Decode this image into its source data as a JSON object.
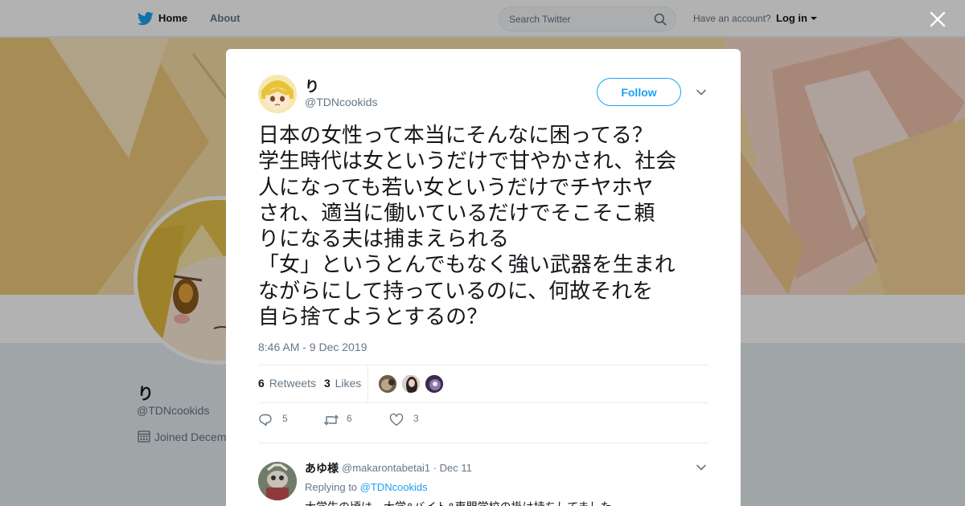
{
  "nav": {
    "home_label": "Home",
    "about_label": "About",
    "search_placeholder": "Search Twitter",
    "have_account": "Have an account?",
    "login_label": "Log in"
  },
  "profile_bg": {
    "name": "り",
    "handle": "@TDNcookids",
    "joined": "Joined Decem"
  },
  "tweet": {
    "author_name": "り",
    "author_handle": "@TDNcookids",
    "follow_label": "Follow",
    "text": "日本の女性って本当にそんなに困ってる？\n学生時代は女というだけで甘やかされ、社会\n人になっても若い女というだけでチヤホヤ\nされ、適当に働いているだけでそこそこ頼\nりになる夫は捕まえられる\n「女」というとんでもなく強い武器を生まれ\nながらにして持っているのに、何故それを\n自ら捨てようとするの？",
    "timestamp": "8:46 AM - 9 Dec 2019",
    "retweets_count": "6",
    "retweets_label": "Retweets",
    "likes_count": "3",
    "likes_label": "Likes",
    "actions": {
      "replies": "5",
      "retweets": "6",
      "likes": "3"
    }
  },
  "reply": {
    "name": "あゆ様",
    "meta": "@makarontabetai1 · Dec 11",
    "replying_label": "Replying to",
    "replying_handle": "@TDNcookids",
    "text": "大学生の頃は、大学&バイト&専門学校の掛け持ちしてました"
  },
  "icons": {
    "brand": "twitter-bird-icon",
    "search": "search-icon",
    "close": "close-icon",
    "calendar": "calendar-icon",
    "chevron": "chevron-down-icon",
    "reply": "reply-icon",
    "retweet": "retweet-icon",
    "like": "heart-icon"
  },
  "colors": {
    "accent": "#1da1f2",
    "text": "#14171a",
    "secondary": "#657786"
  }
}
